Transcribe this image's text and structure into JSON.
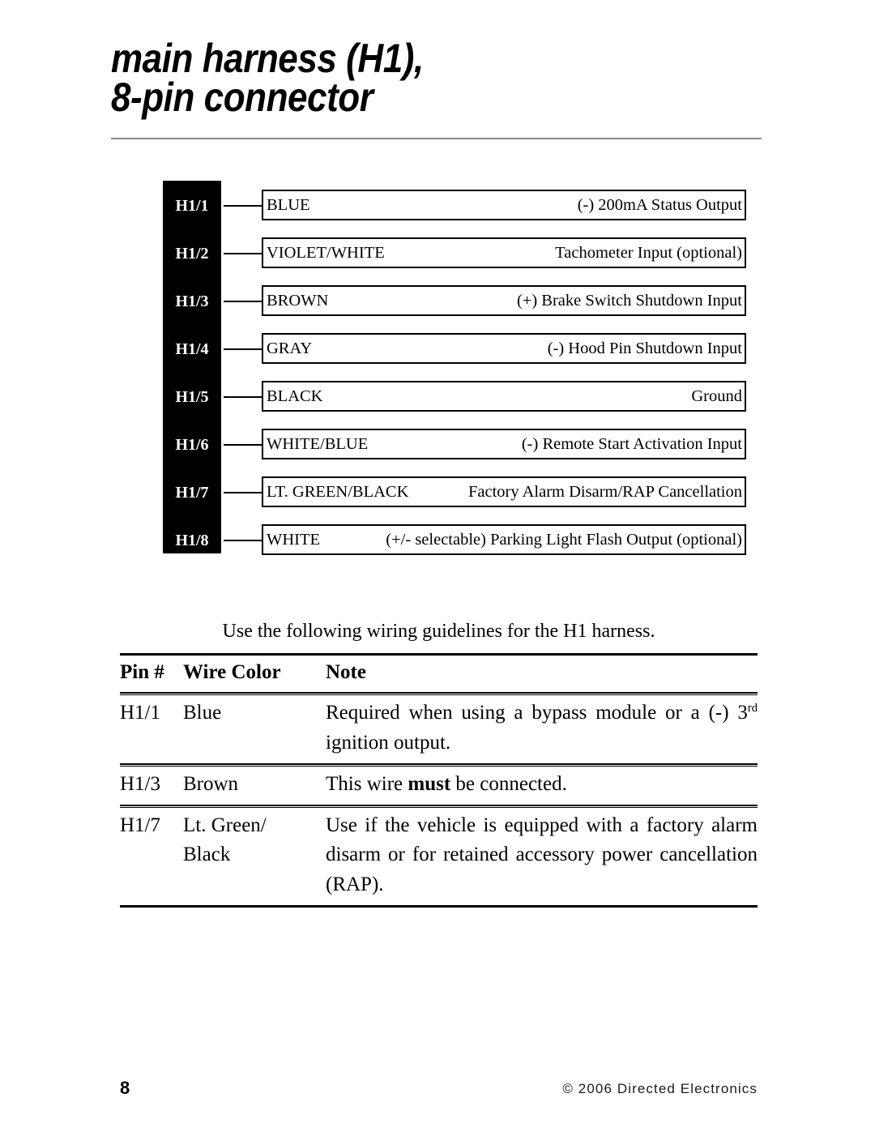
{
  "title": {
    "line1": "main harness (H1),",
    "line2": "8-pin connector"
  },
  "connector_diagram": {
    "rows": [
      {
        "pin": "H1/1",
        "color": "BLUE",
        "function": "(-) 200mA Status Output"
      },
      {
        "pin": "H1/2",
        "color": "VIOLET/WHITE",
        "function": "Tachometer Input (optional)"
      },
      {
        "pin": "H1/3",
        "color": "BROWN",
        "function": "(+) Brake Switch Shutdown Input"
      },
      {
        "pin": "H1/4",
        "color": "GRAY",
        "function": "(-) Hood Pin Shutdown Input"
      },
      {
        "pin": "H1/5",
        "color": "BLACK",
        "function": "Ground"
      },
      {
        "pin": "H1/6",
        "color": "WHITE/BLUE",
        "function": "(-) Remote Start Activation Input"
      },
      {
        "pin": "H1/7",
        "color": "LT. GREEN/BLACK",
        "function": "Factory Alarm Disarm/RAP Cancellation"
      },
      {
        "pin": "H1/8",
        "color": "WHITE",
        "function": "(+/- selectable) Parking Light Flash Output (optional)"
      }
    ]
  },
  "guidelines": {
    "intro": "Use the following wiring guidelines for the H1 harness.",
    "headers": {
      "pin": "Pin #",
      "color": "Wire Color",
      "note": "Note"
    },
    "rows": [
      {
        "pin": "H1/1",
        "color": "Blue",
        "note_pre": "Required when using a bypass module or a (-) 3",
        "note_sup": "rd",
        "note_post": " ignition output.",
        "note_plain": "Required when using a bypass module or a (-) 3rd ignition output."
      },
      {
        "pin": "H1/3",
        "color": "Brown",
        "note_pre": "This wire ",
        "note_bold": "must",
        "note_post": " be connected.",
        "note_plain": "This wire must be connected."
      },
      {
        "pin": "H1/7",
        "color": "Lt. Green/ Black",
        "color_line1": "Lt. Green/",
        "color_line2": "Black",
        "note_plain": "Use if the vehicle is equipped with a factory alarm disarm or for retained accessory power cancellation (RAP)."
      }
    ]
  },
  "footer": {
    "page_number": "8",
    "copyright": "© 2006 Directed Electronics"
  }
}
